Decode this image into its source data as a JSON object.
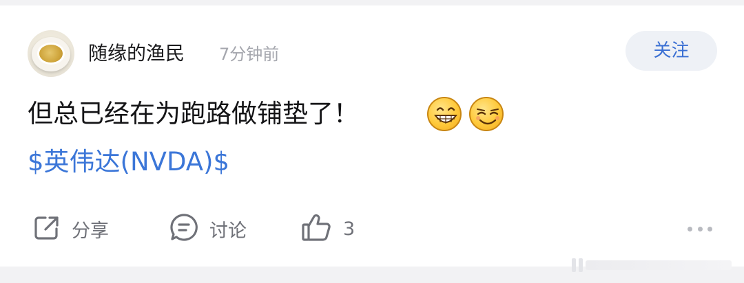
{
  "post": {
    "author": {
      "name": "随缘的渔民",
      "avatar": "tea-cup-avatar",
      "posted_ago": "7分钟前"
    },
    "follow_label": "关注",
    "text": "但总已经在为跑路做铺垫了！",
    "emojis": [
      "grinning-face",
      "smirking-face"
    ],
    "stock_tag": "$英伟达(NVDA)$"
  },
  "actions": {
    "share_label": "分享",
    "discuss_label": "讨论",
    "like_count": "3"
  },
  "colors": {
    "link_blue": "#3b76d8",
    "follow_text": "#3a6fd3",
    "follow_bg": "#eef1f6",
    "muted_text": "#a4a6ad",
    "icon_gray": "#6f7178"
  }
}
